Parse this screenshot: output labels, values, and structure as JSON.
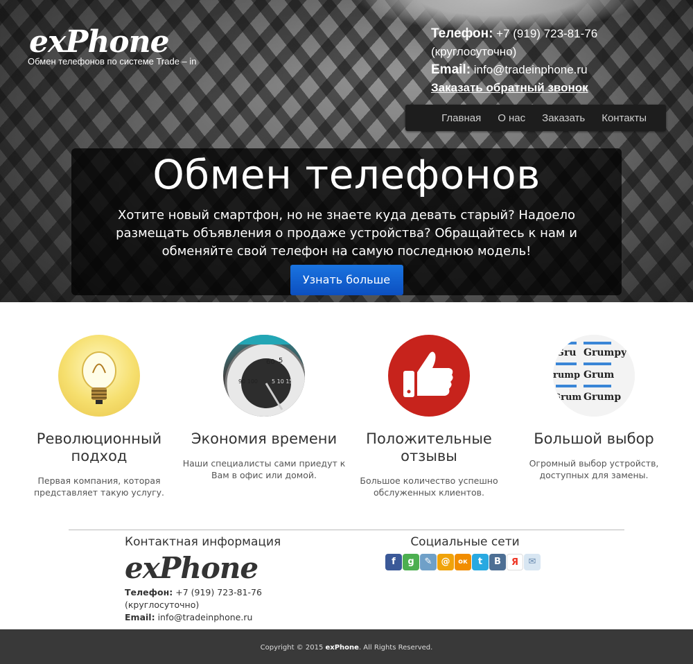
{
  "header": {
    "logo": "exPhone",
    "tagline": "Обмен телефонов по системе Trade – in",
    "phone_label": "Телефон:",
    "phone": "+7 (919) 723-81-76",
    "hours": "(круглосуточно)",
    "email_label": "Email:",
    "email": "info@tradeinphone.ru",
    "callback": "Заказать обратный звонок"
  },
  "nav": {
    "items": [
      {
        "label": "Главная"
      },
      {
        "label": "О нас"
      },
      {
        "label": "Заказать"
      },
      {
        "label": "Контакты"
      }
    ]
  },
  "banner": {
    "title": "Обмен телефонов",
    "text": "Хотите новый смартфон, но не знаете куда девать старый? Надоело размещать объявления о продаже устройства? Обращайтесь к нам и обменяйте свой телефон на самую последнюю модель!",
    "button": "Узнать больше"
  },
  "features": [
    {
      "icon": "lightbulb-icon",
      "title": "Революционный подход",
      "text": "Первая компания, которая представляет такую услугу."
    },
    {
      "icon": "speedometer-icon",
      "title": "Экономия времени",
      "text": "Наши специалисты сами приедут к Вам в офис или домой."
    },
    {
      "icon": "thumbs-up-icon",
      "title": "Положительные отзывы",
      "text": "Большое количество успешно обслуженных клиентов."
    },
    {
      "icon": "font-samples-icon",
      "title": "Большой выбор",
      "text": "Огромный выбор устройств, доступных для замены."
    }
  ],
  "contact": {
    "title": "Контактная информация",
    "logo": "exPhone",
    "phone_label": "Телефон:",
    "phone": "+7 (919) 723-81-76",
    "hours": "(круглосуточно)",
    "email_label": "Email:",
    "email": "info@tradeinphone.ru"
  },
  "social": {
    "title": "Социальные сети",
    "icons": [
      {
        "name": "facebook-icon",
        "glyph": "f",
        "color": "#3b5998"
      },
      {
        "name": "google-plus-icon",
        "glyph": "g",
        "color": "#4caf50"
      },
      {
        "name": "livejournal-icon",
        "glyph": "✎",
        "color": "#6fa0c8"
      },
      {
        "name": "mail-ru-icon",
        "glyph": "@",
        "color": "#f0a30a"
      },
      {
        "name": "odnoklassniki-icon",
        "glyph": "ок",
        "color": "#f18d00"
      },
      {
        "name": "twitter-icon",
        "glyph": "t",
        "color": "#29a9e1"
      },
      {
        "name": "vkontakte-icon",
        "glyph": "В",
        "color": "#4d6f94"
      },
      {
        "name": "yandex-icon",
        "glyph": "Я",
        "color": "#ffffff"
      },
      {
        "name": "email-icon",
        "glyph": "✉",
        "color": "#d8e6f2"
      }
    ]
  },
  "footer": {
    "copyright": "Copyright © 2015",
    "brand": "exPhone",
    "rights": ". All Rights Reserved."
  }
}
